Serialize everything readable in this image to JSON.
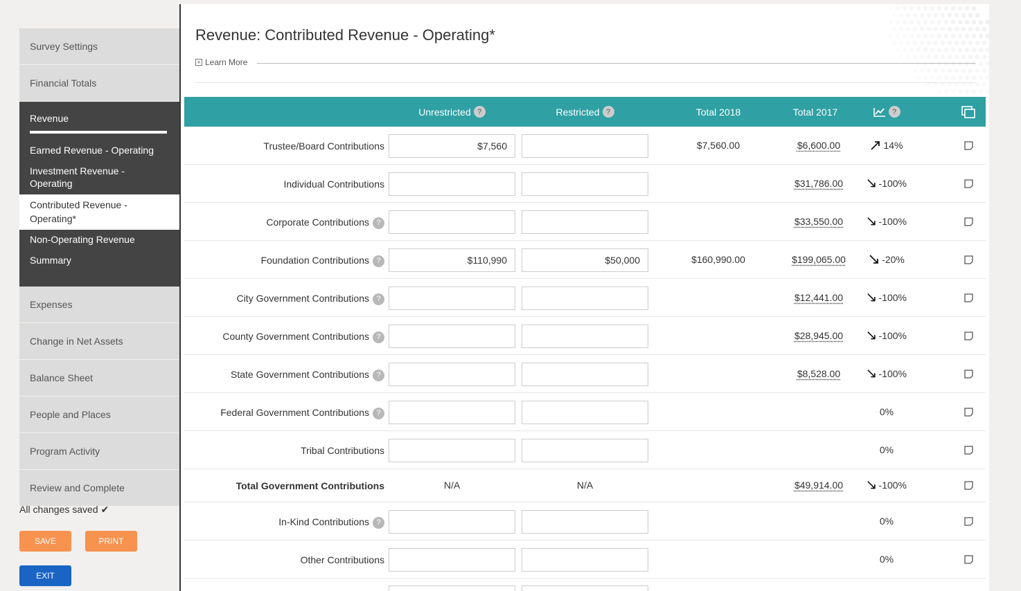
{
  "sidebar": {
    "items_top": [
      "Survey Settings",
      "Financial Totals"
    ],
    "group": {
      "title": "Revenue",
      "subitems": [
        {
          "label": "Earned Revenue - Operating",
          "active": false
        },
        {
          "label": "Investment Revenue - Operating",
          "active": false
        },
        {
          "label": "Contributed Revenue - Operating*",
          "active": true
        },
        {
          "label": "Non-Operating Revenue",
          "active": false
        },
        {
          "label": "Summary",
          "active": false
        }
      ]
    },
    "items_bottom": [
      "Expenses",
      "Change in Net Assets",
      "Balance Sheet",
      "People and Places",
      "Program Activity",
      "Review and Complete"
    ]
  },
  "status": {
    "text": "All changes saved",
    "icon": "check-icon"
  },
  "buttons": {
    "save": "SAVE",
    "print": "PRINT",
    "exit": "EXIT"
  },
  "page": {
    "title": "Revenue: Contributed Revenue - Operating*",
    "learn_more": "Learn More"
  },
  "table": {
    "headers": {
      "unrestricted": "Unrestricted",
      "restricted": "Restricted",
      "total_2018": "Total 2018",
      "total_2017": "Total 2017",
      "trend_icon": "trend-chart-icon",
      "copy_icon": "copy-icon"
    },
    "help_glyph": "?",
    "rows": [
      {
        "label": "Trustee/Board Contributions",
        "help": false,
        "unrestricted": "$7,560",
        "restricted": "",
        "total_2018": "$7,560.00",
        "total_2017": "$6,600.00",
        "trend": "up",
        "pct": "14%"
      },
      {
        "label": "Individual Contributions",
        "help": false,
        "unrestricted": "",
        "restricted": "",
        "total_2018": "",
        "total_2017": "$31,786.00",
        "trend": "down",
        "pct": "-100%"
      },
      {
        "label": "Corporate Contributions",
        "help": true,
        "unrestricted": "",
        "restricted": "",
        "total_2018": "",
        "total_2017": "$33,550.00",
        "trend": "down",
        "pct": "-100%"
      },
      {
        "label": "Foundation Contributions",
        "help": true,
        "unrestricted": "$110,990",
        "restricted": "$50,000",
        "total_2018": "$160,990.00",
        "total_2017": "$199,065.00",
        "trend": "down",
        "pct": "-20%"
      },
      {
        "label": "City Government Contributions",
        "help": true,
        "unrestricted": "",
        "restricted": "",
        "total_2018": "",
        "total_2017": "$12,441.00",
        "trend": "down",
        "pct": "-100%"
      },
      {
        "label": "County Government Contributions",
        "help": true,
        "unrestricted": "",
        "restricted": "",
        "total_2018": "",
        "total_2017": "$28,945.00",
        "trend": "down",
        "pct": "-100%"
      },
      {
        "label": "State Government Contributions",
        "help": true,
        "unrestricted": "",
        "restricted": "",
        "total_2018": "",
        "total_2017": "$8,528.00",
        "trend": "down",
        "pct": "-100%"
      },
      {
        "label": "Federal Government Contributions",
        "help": true,
        "unrestricted": "",
        "restricted": "",
        "total_2018": "",
        "total_2017": "",
        "trend": "none",
        "pct": "0%"
      },
      {
        "label": "Tribal Contributions",
        "help": false,
        "unrestricted": "",
        "restricted": "",
        "total_2018": "",
        "total_2017": "",
        "trend": "none",
        "pct": "0%"
      },
      {
        "label": "Total Government Contributions",
        "help": false,
        "bold": true,
        "readonly": true,
        "unrestricted": "N/A",
        "restricted": "N/A",
        "total_2018": "",
        "total_2017": "$49,914.00",
        "trend": "down",
        "pct": "-100%"
      },
      {
        "label": "In-Kind Contributions",
        "help": true,
        "unrestricted": "",
        "restricted": "",
        "total_2018": "",
        "total_2017": "",
        "trend": "none",
        "pct": "0%"
      },
      {
        "label": "Other Contributions",
        "help": false,
        "unrestricted": "",
        "restricted": "",
        "total_2018": "",
        "total_2017": "",
        "trend": "none",
        "pct": "0%"
      }
    ]
  }
}
